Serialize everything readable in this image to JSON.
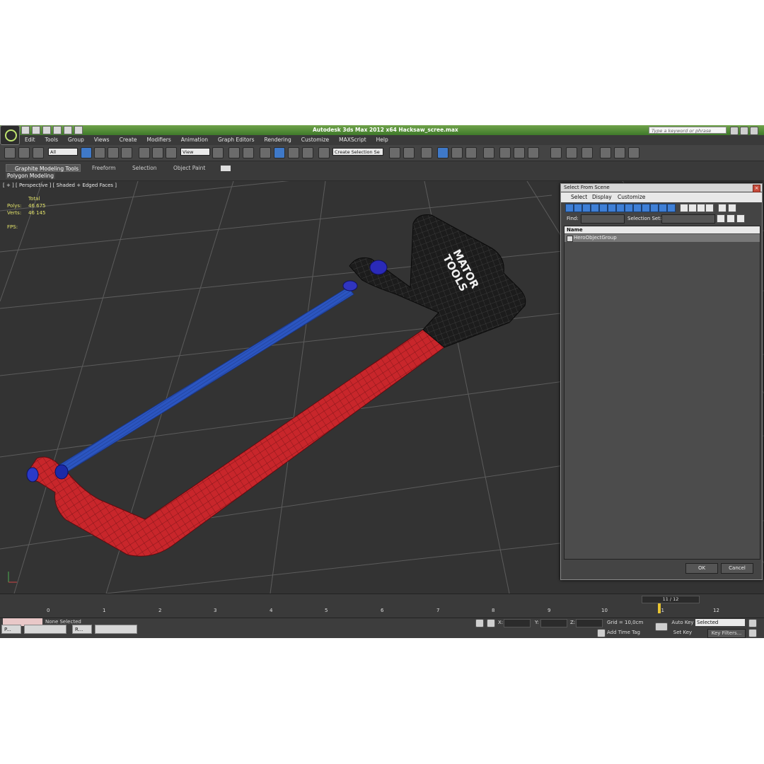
{
  "titlebar": {
    "title": "Autodesk 3ds Max  2012 x64      Hacksaw_scree.max",
    "search_placeholder": "Type a keyword or phrase"
  },
  "menu": [
    "Edit",
    "Tools",
    "Group",
    "Views",
    "Create",
    "Modifiers",
    "Animation",
    "Graph Editors",
    "Rendering",
    "Customize",
    "MAXScript",
    "Help"
  ],
  "toolbar": {
    "filter_value": "All",
    "ref_coord_value": "View",
    "selection_set_value": "Create Selection Se",
    "snap_label": "3"
  },
  "ribbon": {
    "tabs": [
      "Graphite Modeling Tools",
      "Freeform",
      "Selection",
      "Object Paint"
    ],
    "panel_label": "Polygon Modeling"
  },
  "viewport": {
    "label": "[ + ] [ Perspective ] [ Shaded + Edged Faces ]",
    "stats_header": "Total",
    "polys_label": "Polys:",
    "polys_value": "46 675",
    "verts_label": "Verts:",
    "verts_value": "46 145",
    "fps_label": "FPS:",
    "logo_text_1": "MATOR",
    "logo_text_2": "TOOLS"
  },
  "dialog": {
    "title": "Select From Scene",
    "menu": [
      "Select",
      "Display",
      "Customize"
    ],
    "find_label": "Find:",
    "selection_set_label": "Selection Set:",
    "column_name": "Name",
    "rows": [
      "HeroObjectGroup"
    ],
    "ok_label": "OK",
    "cancel_label": "Cancel"
  },
  "timeline": {
    "frame_display": "11 / 12",
    "ticks": [
      "0",
      "1",
      "2",
      "3",
      "4",
      "5",
      "6",
      "7",
      "8",
      "9",
      "10",
      "11",
      "12"
    ]
  },
  "status": {
    "selection_text": "None Selected",
    "x_label": "X:",
    "y_label": "Y:",
    "z_label": "Z:",
    "grid_text": "Grid = 10,0cm",
    "add_time_tag": "Add Time Tag",
    "auto_key": "Auto Key",
    "set_key": "Set Key",
    "key_mode_value": "Selected",
    "key_filters": "Key Filters..."
  },
  "taskbar": {
    "items": [
      "P...",
      "R..."
    ]
  },
  "colors": {
    "title_green": "#4f8b34",
    "frame_red": "#c8262b",
    "blade_blue": "#2b55c0",
    "handle_black": "#1c1c1c",
    "viewport_bg": "#333333"
  }
}
